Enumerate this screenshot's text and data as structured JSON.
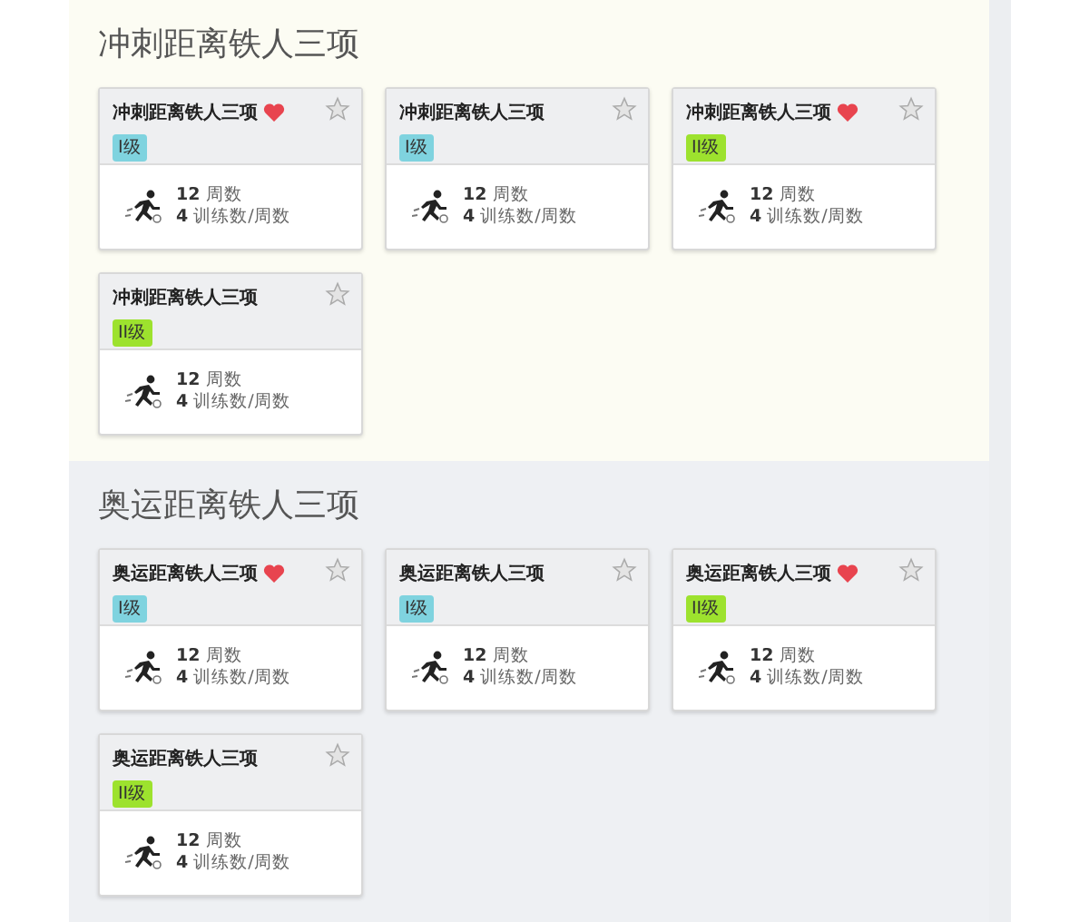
{
  "sections": [
    {
      "title": "冲刺距离铁人三项",
      "plans": [
        {
          "title": "冲刺距离铁人三项",
          "favorite": true,
          "starred": false,
          "badge": "I级",
          "color": "#7fd3df",
          "weeks": "12",
          "weeks_unit": "周数",
          "sessions": "4",
          "sessions_unit": "训练数/周数"
        },
        {
          "title": "冲刺距离铁人三项",
          "favorite": false,
          "starred": false,
          "badge": "I级",
          "color": "#7fd3df",
          "weeks": "12",
          "weeks_unit": "周数",
          "sessions": "4",
          "sessions_unit": "训练数/周数"
        },
        {
          "title": "冲刺距离铁人三项",
          "favorite": true,
          "starred": false,
          "badge": "II级",
          "color": "#9de22e",
          "weeks": "12",
          "weeks_unit": "周数",
          "sessions": "4",
          "sessions_unit": "训练数/周数"
        },
        {
          "title": "冲刺距离铁人三项",
          "favorite": false,
          "starred": false,
          "badge": "II级",
          "color": "#9de22e",
          "weeks": "12",
          "weeks_unit": "周数",
          "sessions": "4",
          "sessions_unit": "训练数/周数"
        }
      ]
    },
    {
      "title": "奥运距离铁人三项",
      "plans": [
        {
          "title": "奥运距离铁人三项",
          "favorite": true,
          "starred": false,
          "badge": "I级",
          "color": "#7fd3df",
          "weeks": "12",
          "weeks_unit": "周数",
          "sessions": "4",
          "sessions_unit": "训练数/周数"
        },
        {
          "title": "奥运距离铁人三项",
          "favorite": false,
          "starred": false,
          "badge": "I级",
          "color": "#7fd3df",
          "weeks": "12",
          "weeks_unit": "周数",
          "sessions": "4",
          "sessions_unit": "训练数/周数"
        },
        {
          "title": "奥运距离铁人三项",
          "favorite": true,
          "starred": false,
          "badge": "II级",
          "color": "#9de22e",
          "weeks": "12",
          "weeks_unit": "周数",
          "sessions": "4",
          "sessions_unit": "训练数/周数"
        },
        {
          "title": "奥运距离铁人三项",
          "favorite": false,
          "starred": false,
          "badge": "II级",
          "color": "#9de22e",
          "weeks": "12",
          "weeks_unit": "周数",
          "sessions": "4",
          "sessions_unit": "训练数/周数"
        }
      ]
    }
  ]
}
